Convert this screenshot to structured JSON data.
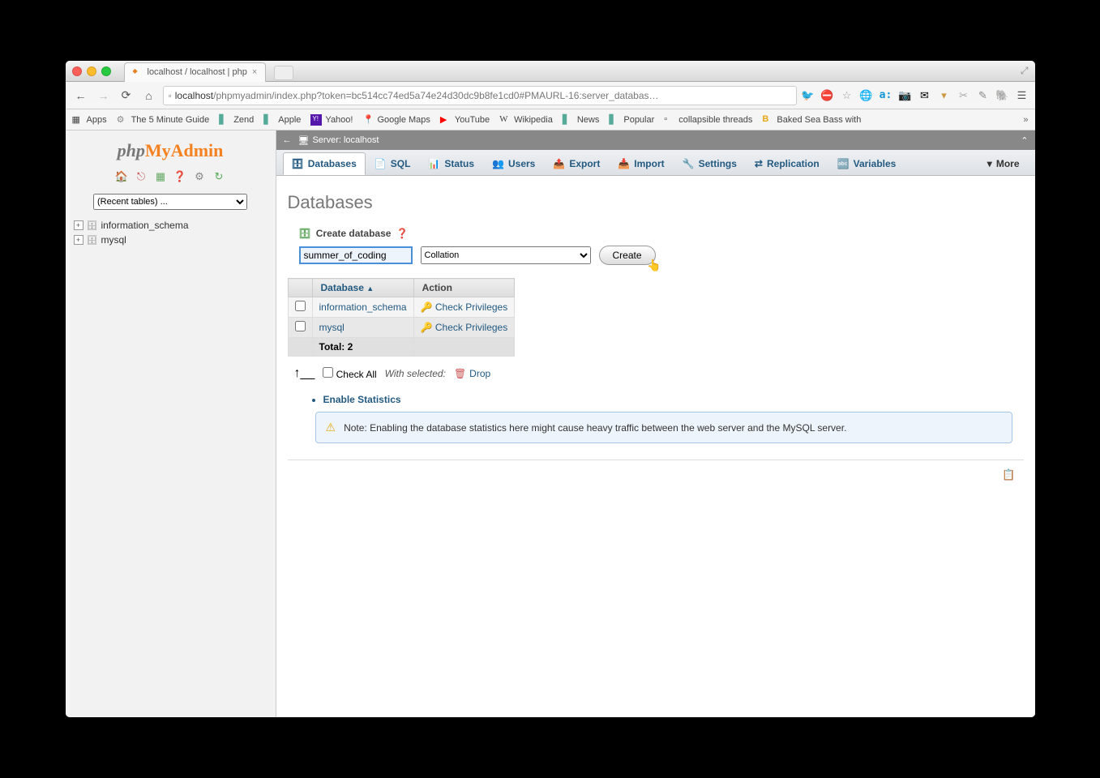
{
  "browser": {
    "tab_title": "localhost / localhost | php",
    "url_host": "localhost",
    "url_path": "/phpmyadmin/index.php?token=bc514cc74ed5a74e24d30dc9b8fe1cd0#PMAURL-16:server_databas…",
    "bookmarks": [
      "Apps",
      "The 5 Minute Guide",
      "Zend",
      "Apple",
      "Yahoo!",
      "Google Maps",
      "YouTube",
      "Wikipedia",
      "News",
      "Popular",
      "collapsible threads",
      "Baked Sea Bass with"
    ]
  },
  "sidebar": {
    "recent_label": "(Recent tables) ...",
    "tree": [
      "information_schema",
      "mysql"
    ]
  },
  "breadcrumb": {
    "server_label": "Server: localhost"
  },
  "tabs": [
    "Databases",
    "SQL",
    "Status",
    "Users",
    "Export",
    "Import",
    "Settings",
    "Replication",
    "Variables",
    "More"
  ],
  "page": {
    "heading": "Databases",
    "create_label": "Create database",
    "db_name_value": "summer_of_coding",
    "collation_label": "Collation",
    "create_btn": "Create",
    "col_database": "Database",
    "col_action": "Action",
    "rows": [
      {
        "name": "information_schema",
        "action": "Check Privileges"
      },
      {
        "name": "mysql",
        "action": "Check Privileges"
      }
    ],
    "total_label": "Total: 2",
    "check_all": "Check All",
    "with_selected": "With selected:",
    "drop": "Drop",
    "enable_stats": "Enable Statistics",
    "note": "Note: Enabling the database statistics here might cause heavy traffic between the web server and the MySQL server."
  }
}
